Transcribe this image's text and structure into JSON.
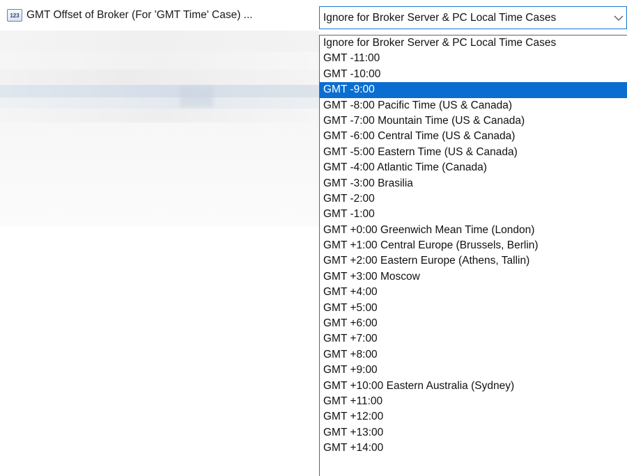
{
  "property": {
    "icon": "numeric-123-icon",
    "icon_text": "123",
    "name": "GMT Offset of Broker (For 'GMT Time' Case) ..."
  },
  "combo": {
    "value": "Ignore for Broker Server & PC Local Time Cases",
    "chevron_icon": "chevron-down-icon"
  },
  "dropdown": {
    "selected_index": 3,
    "selected_color": "#0a6ed1",
    "options": [
      "Ignore for Broker Server & PC Local Time Cases",
      "GMT -11:00",
      "GMT -10:00",
      "GMT -9:00",
      "GMT -8:00  Pacific Time (US & Canada)",
      "GMT -7:00  Mountain Time (US & Canada)",
      "GMT -6:00  Central Time (US & Canada)",
      "GMT -5:00  Eastern Time (US & Canada)",
      "GMT -4:00  Atlantic Time (Canada)",
      "GMT -3:00  Brasilia",
      "GMT -2:00",
      "GMT -1:00",
      "GMT +0:00  Greenwich Mean Time (London)",
      "GMT +1:00  Central Europe (Brussels, Berlin)",
      "GMT +2:00  Eastern Europe (Athens, Tallin)",
      "GMT +3:00  Moscow",
      "GMT +4:00",
      "GMT +5:00",
      "GMT +6:00",
      "GMT +7:00",
      "GMT +8:00",
      "GMT +9:00",
      "GMT +10:00 Eastern Australia (Sydney)",
      "GMT +11:00",
      "GMT +12:00",
      "GMT +13:00",
      "GMT +14:00"
    ]
  }
}
